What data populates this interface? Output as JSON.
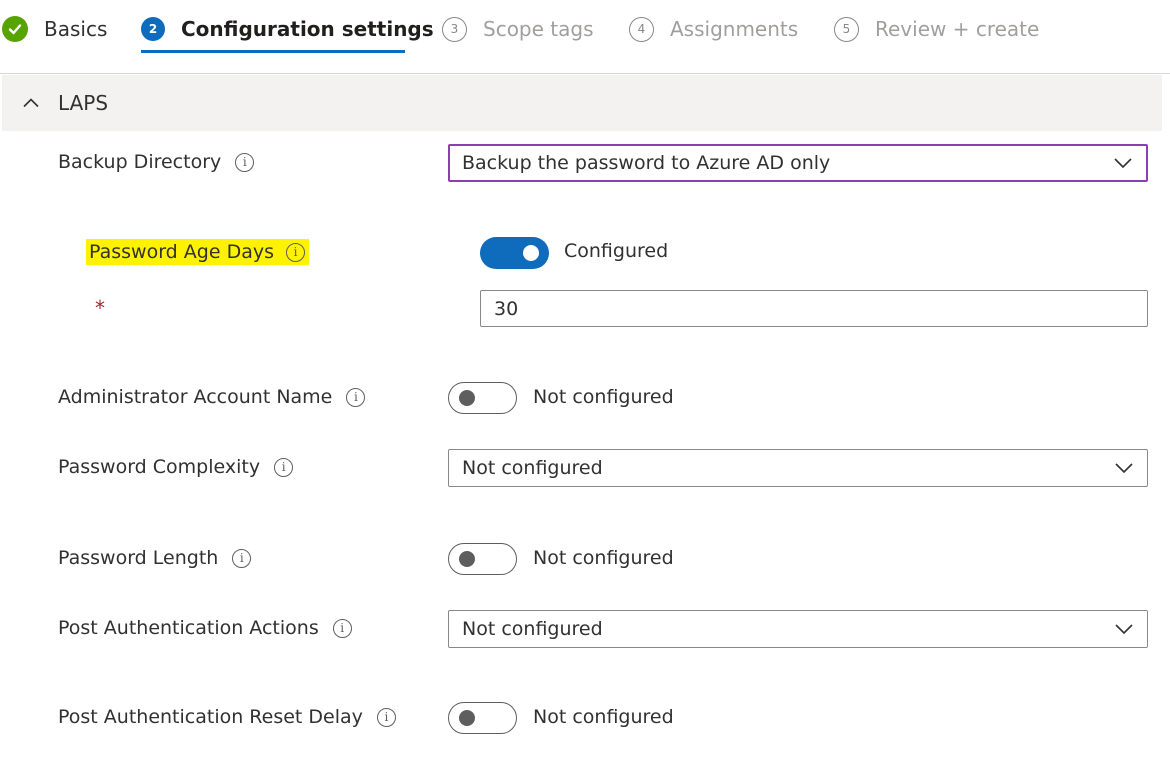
{
  "wizard": {
    "steps": [
      {
        "number": "",
        "label": "Basics",
        "state": "done"
      },
      {
        "number": "2",
        "label": "Configuration settings",
        "state": "active"
      },
      {
        "number": "3",
        "label": "Scope tags",
        "state": "pending"
      },
      {
        "number": "4",
        "label": "Assignments",
        "state": "pending"
      },
      {
        "number": "5",
        "label": "Review + create",
        "state": "pending"
      }
    ]
  },
  "section": {
    "title": "LAPS",
    "icon": "chevron-up-icon"
  },
  "settings": {
    "backup_directory": {
      "label": "Backup Directory",
      "value": "Backup the password to Azure AD only"
    },
    "password_age_days": {
      "label": "Password Age Days",
      "toggle_state": "Configured",
      "required_marker": "*",
      "value": "30"
    },
    "admin_account_name": {
      "label": "Administrator Account Name",
      "toggle_state": "Not configured"
    },
    "password_complexity": {
      "label": "Password Complexity",
      "value": "Not configured"
    },
    "password_length": {
      "label": "Password Length",
      "toggle_state": "Not configured"
    },
    "post_auth_actions": {
      "label": "Post Authentication Actions",
      "value": "Not configured"
    },
    "post_auth_reset_delay": {
      "label": "Post Authentication Reset Delay",
      "toggle_state": "Not configured"
    }
  },
  "icons": {
    "info": "i"
  },
  "colors": {
    "accent": "#0f6cbd",
    "success": "#57a300",
    "focus_border": "#8a3fb4",
    "highlight": "#fff200",
    "required": "#a4262c"
  }
}
